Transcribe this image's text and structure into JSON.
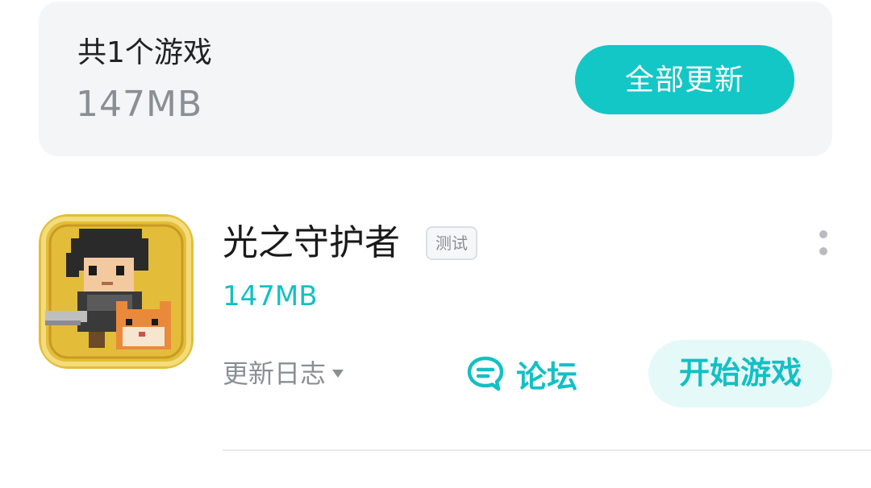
{
  "summary": {
    "count_text": "共1个游戏",
    "total_size": "147MB",
    "update_all_label": "全部更新"
  },
  "game": {
    "title": "光之守护者",
    "badge": "测试",
    "size": "147MB",
    "changelog_label": "更新日志",
    "forum_label": "论坛",
    "start_label": "开始游戏",
    "icon": "game-cover-pixel-art"
  },
  "colors": {
    "accent": "#13c0c4",
    "accent_button": "#13c7c6",
    "card_bg": "#f3f5f7",
    "start_bg": "#e6f9f9"
  }
}
